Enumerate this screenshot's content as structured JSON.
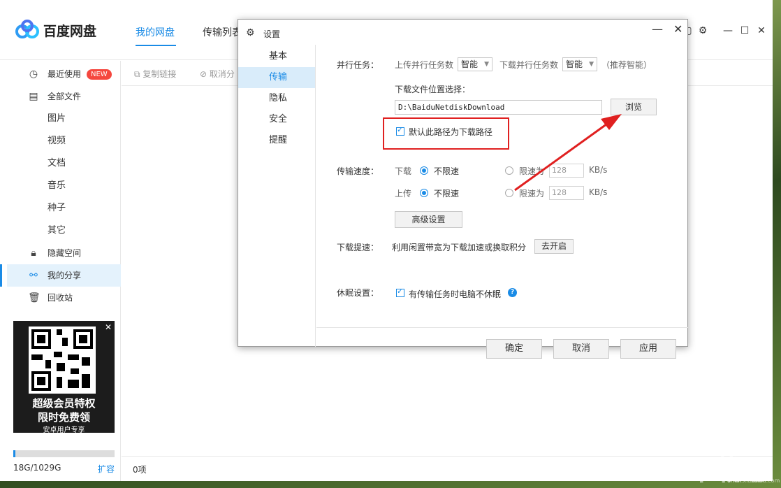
{
  "app": {
    "title": "百度网盘",
    "nav_tabs": [
      {
        "label": "我的网盘"
      },
      {
        "label": "传输列表"
      }
    ]
  },
  "sidebar": {
    "items": [
      {
        "label": "最近使用",
        "icon": "clock-icon",
        "badge": "NEW"
      },
      {
        "label": "全部文件",
        "icon": "file-icon"
      },
      {
        "label": "隐藏空间",
        "icon": "lock-icon"
      },
      {
        "label": "我的分享",
        "icon": "share-icon"
      },
      {
        "label": "回收站",
        "icon": "trash-icon"
      }
    ],
    "subitems": [
      "图片",
      "视频",
      "文档",
      "音乐",
      "种子",
      "其它"
    ]
  },
  "ad": {
    "line1": "超级会员特权",
    "line2": "限时免费领",
    "line3": "安卓用户专享",
    "close": "✕"
  },
  "quota": {
    "text": "18G/1029G",
    "link": "扩容",
    "used_fraction": 0.0175
  },
  "toolbar": {
    "copy_link": "复制链接",
    "cancel": "取消分"
  },
  "footer": {
    "count": "0项"
  },
  "watermark": {
    "text": "下载吧",
    "sub": "www.xiazaiba.com"
  },
  "dialog": {
    "title": "设置",
    "nav": [
      "基本",
      "传输",
      "隐私",
      "安全",
      "提醒"
    ],
    "parallel": {
      "label": "并行任务：",
      "upload_label": "上传并行任务数",
      "upload_value": "智能",
      "download_label": "下载并行任务数",
      "download_value": "智能",
      "hint": "（推荐智能）"
    },
    "location": {
      "label": "下载文件位置选择：",
      "path": "D:\\BaiduNetdiskDownload",
      "browse": "浏览",
      "default_check": "默认此路径为下载路径"
    },
    "speed": {
      "label": "传输速度：",
      "download": "下载",
      "upload": "上传",
      "unlimited": "不限速",
      "limit_to": "限速为",
      "download_limit": "128",
      "upload_limit": "128",
      "unit": "KB/s",
      "advanced": "高级设置"
    },
    "boost": {
      "label": "下载提速：",
      "desc": "利用闲置带宽为下载加速或换取积分",
      "button": "去开启"
    },
    "sleep": {
      "label": "休眠设置：",
      "check": "有传输任务时电脑不休眠"
    },
    "buttons": {
      "ok": "确定",
      "cancel": "取消",
      "apply": "应用"
    }
  }
}
